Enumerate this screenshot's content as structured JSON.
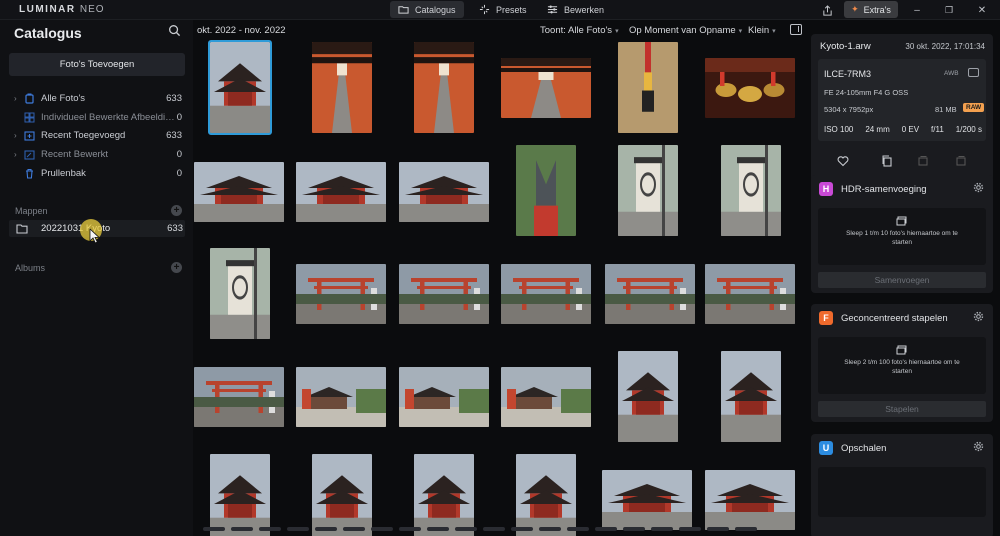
{
  "app": {
    "logo_main": "LUMINAR",
    "logo_sub": "NEO"
  },
  "top_tabs": [
    {
      "label": "Catalogus",
      "icon": "folder-icon",
      "active": true
    },
    {
      "label": "Presets",
      "icon": "sparkle-icon",
      "active": false
    },
    {
      "label": "Bewerken",
      "icon": "sliders-icon",
      "active": false
    }
  ],
  "extras_label": "Extra's",
  "sidebar": {
    "title": "Catalogus",
    "add_photos": "Foto's Toevoegen",
    "items": [
      {
        "label": "Alle Foto's",
        "count": "633",
        "icon": "photo-stack-icon"
      },
      {
        "label": "Individueel Bewerkte Afbeeldingen",
        "count": "0",
        "icon": "grid-icon"
      },
      {
        "label": "Recent Toegevoegd",
        "count": "633",
        "icon": "recent-add-icon"
      },
      {
        "label": "Recent Bewerkt",
        "count": "0",
        "icon": "recent-edit-icon"
      },
      {
        "label": "Prullenbak",
        "count": "0",
        "icon": "trash-icon"
      }
    ],
    "folders_heading": "Mappen",
    "folder": {
      "label": "20221031 Kyoto",
      "count": "633"
    },
    "albums_heading": "Albums"
  },
  "toolbar": {
    "date_range": "okt. 2022 - nov. 2022",
    "show_filter": "Toont: Alle Foto's",
    "sort": "Op Moment van Opname",
    "size": "Klein"
  },
  "info": {
    "file_name": "Kyoto-1.arw",
    "date": "30 okt. 2022, 17:01:34",
    "camera": "ILCE-7RM3",
    "awb": "AWB",
    "lens": "FE 24-105mm F4 G OSS",
    "dimensions": "5304 x 7952px",
    "file_size": "81 MB",
    "raw": "RAW",
    "iso": "ISO 100",
    "focal": "24 mm",
    "ev": "0 EV",
    "aperture": "f/11",
    "shutter": "1/200 s"
  },
  "tools": [
    {
      "name": "HDR-samenvoeging",
      "badge": "H",
      "color": "#c94ad6",
      "drop_text": "Sleep 1 t/m 10 foto's hiernaartoe om te starten",
      "action": "Samenvoegen"
    },
    {
      "name": "Geconcentreerd stapelen",
      "badge": "F",
      "color": "#ef6a2c",
      "drop_text": "Sleep 2 t/m 100 foto's hiernaartoe om te starten",
      "action": "Stapelen"
    },
    {
      "name": "Opschalen",
      "badge": "U",
      "color": "#2c8ce0"
    }
  ],
  "thumbnails": [
    {
      "type": "temple",
      "selected": true
    },
    {
      "type": "tunnel"
    },
    {
      "type": "tunnel"
    },
    {
      "type": "tunnel"
    },
    {
      "type": "bell"
    },
    {
      "type": "bells"
    },
    {
      "type": "temple"
    },
    {
      "type": "temple"
    },
    {
      "type": "temple"
    },
    {
      "type": "fox"
    },
    {
      "type": "lantern"
    },
    {
      "type": "lantern"
    },
    {
      "type": "lantern"
    },
    {
      "type": "gate"
    },
    {
      "type": "gate"
    },
    {
      "type": "gate"
    },
    {
      "type": "gate"
    },
    {
      "type": "gate"
    },
    {
      "type": "gate"
    },
    {
      "type": "courtyard"
    },
    {
      "type": "courtyard"
    },
    {
      "type": "courtyard"
    },
    {
      "type": "temple"
    },
    {
      "type": "temple"
    },
    {
      "type": "temple"
    },
    {
      "type": "temple"
    },
    {
      "type": "temple"
    },
    {
      "type": "temple"
    },
    {
      "type": "temple"
    },
    {
      "type": "temple"
    }
  ]
}
